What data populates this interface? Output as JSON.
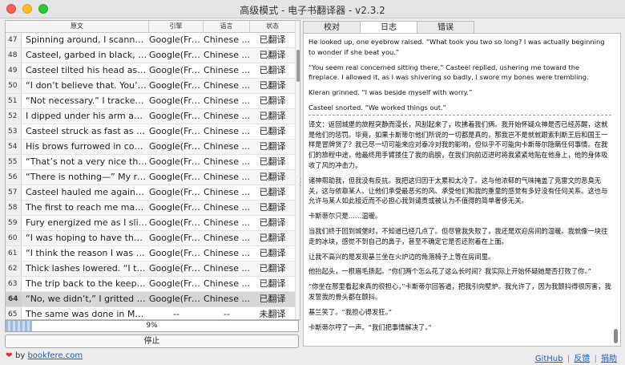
{
  "window": {
    "title": "高级模式 - 电子书翻译器 - v2.3.2"
  },
  "table": {
    "headers": [
      "原文",
      "引擎",
      "语言",
      "状态"
    ],
    "rows": [
      {
        "num": "47",
        "text": "Spinning around, I scanned the trees ...",
        "engine": "Google(Free)",
        "lang": "Chinese ...",
        "status": "已翻译"
      },
      {
        "num": "48",
        "text": "Casteel, garbed in black, cut a strikin...",
        "engine": "Google(Free)",
        "lang": "Chinese ...",
        "status": "已翻译"
      },
      {
        "num": "49",
        "text": "Casteel tilted his head as the wolven'...",
        "engine": "Google(Free)",
        "lang": "Chinese ...",
        "status": "已翻译"
      },
      {
        "num": "50",
        "text": "“I don’t believe that. You’re smarter ...",
        "engine": "Google(Free)",
        "lang": "Chinese ...",
        "status": "已翻译"
      },
      {
        "num": "51",
        "text": "“Not necessary.” I tracked his ...",
        "engine": "Google(Free)",
        "lang": "Chinese ...",
        "status": "已翻译"
      },
      {
        "num": "52",
        "text": "I dipped under his arm and spun, ...",
        "engine": "Google(Free)",
        "lang": "Chinese ...",
        "status": "已翻译"
      },
      {
        "num": "53",
        "text": "Casteel struck as fast as a falcon wit...",
        "engine": "Google(Free)",
        "lang": "Chinese ...",
        "status": "已翻译"
      },
      {
        "num": "54",
        "text": "His brows furrowed in confusion, and...",
        "engine": "Google(Free)",
        "lang": "Chinese ...",
        "status": "已翻译"
      },
      {
        "num": "55",
        "text": "“That’s not a very nice thing to say.” ...",
        "engine": "Google(Free)",
        "lang": "Chinese ...",
        "status": "已翻译"
      },
      {
        "num": "56",
        "text": "“There is nothing—” My response die...",
        "engine": "Google(Free)",
        "lang": "Chinese ...",
        "status": "已翻译"
      },
      {
        "num": "57",
        "text": "Casteel hauled me against his chest ...",
        "engine": "Google(Free)",
        "lang": "Chinese ...",
        "status": "已翻译"
      },
      {
        "num": "58",
        "text": "The first to reach me may have been ...",
        "engine": "Google(Free)",
        "lang": "Chinese ...",
        "status": "已翻译"
      },
      {
        "num": "59",
        "text": "Fury energized me as I sliced the ...",
        "engine": "Google(Free)",
        "lang": "Chinese ...",
        "status": "已翻译"
      },
      {
        "num": "60",
        "text": "“I was hoping to have the chance to ...",
        "engine": "Google(Free)",
        "lang": "Chinese ...",
        "status": "已翻译"
      },
      {
        "num": "61",
        "text": "“I think the reason I was never allowe...",
        "engine": "Google(Free)",
        "lang": "Chinese ...",
        "status": "已翻译"
      },
      {
        "num": "62",
        "text": "Thick lashes lowered. “I think it’s the ...",
        "engine": "Google(Free)",
        "lang": "Chinese ...",
        "status": "已翻译"
      },
      {
        "num": "63",
        "text": "The trip back to the keep was quiet ...",
        "engine": "Google(Free)",
        "lang": "Chinese ...",
        "status": "已翻译"
      },
      {
        "num": "64",
        "text": "“No, we didn’t,” I gritted out between...",
        "engine": "Google(Free)",
        "lang": "Chinese ...",
        "status": "已翻译"
      },
      {
        "num": "65",
        "text": "The same was done in Masadonia ...",
        "engine": "--",
        "lang": "--",
        "status": "未翻译"
      }
    ]
  },
  "progress": {
    "value": 0.09,
    "label": "9%"
  },
  "stop_button": {
    "label": "停止"
  },
  "tabs": [
    "校对",
    "日志",
    "错误"
  ],
  "log": {
    "en": [
      "He looked up, one eyebrow raised. “What took you two so long? I was actually beginning to wonder if she beat you.”",
      "“You seem real concerned sitting there,” Casteel replied, ushering me toward the fireplace. I allowed it, as I was shivering so badly, I swore my bones were trembling.",
      "Kieran grinned. “I was beside myself with worry.”",
      "Casteel snorted. “We worked things out.”"
    ],
    "zh": [
      "译文：返回城堡的旅程突静而漫长，风刮起来了，吹拂着我们俩。我开始怀疑众神是否已经苏醒，这就是他们的惩罚。毕竟，如果卡斯蒂尔他们所说的一切都是真的，那我岂不是就就跟索利斯王后和国王一样是冒牌货了？我已尽一切可能来应对泰冷对我的影响，但似乎不可能向卡斯蒂尔隐瞒任何事情。在我们的旅程中途，他最终用手臂搂住了我的肩膀，在我们向前迈进时将我紧紧地贴在他身上，他的身体吸收了风的冲击力。",
      "诸神帮助我，但我没有反抗。我把这归因于太累和太冷了。这与他浓郁的气味掩盖了克雷文的恶臭无关，这与依靠某人、让他们承受最恶劣的风、承受他们和我的重量的感觉有多好没有任何关系。这也与允许与某人如此接近而不必担心我到谴责或被认为不值得的简单奢侈无关。",
      "卡斯蒂尔只是……温暖。",
      "当我们终于回到城堡时，不知道已经几点了。但尽管我失败了，我还是欢迎房间的温暖。我就像一块往走的冰块，感觉不到自己的鼻子，甚至不确定它是否还附着在上面。",
      "让我不高兴的是发现基兰坐在火炉边的角落椅子上等在房间里。",
      "他抬起头，一根眉毛扬起。“你们两个怎么花了这么长时间？我实际上开始怀疑她是否打败了你。”",
      "“你坐在那里看起来真的很担心，”卡斯蒂尔回答道，把我引向壁炉。我允许了，因为我颤抖得很厉害，我发誓我的骨头都在颤抖。",
      "基兰笑了。“我担心得发狂。”",
      "卡斯蒂尔哼了一声。“我们把事情解决了。”"
    ]
  },
  "footer": {
    "by_prefix": "by",
    "by_link": "bookfere.com",
    "links": [
      "GitHub",
      "反馈",
      "捐助"
    ],
    "sep": "|"
  },
  "colors": {
    "accent": "#1a5fc7",
    "heart": "#e0283d",
    "selected_row": "#d6d6d6"
  }
}
